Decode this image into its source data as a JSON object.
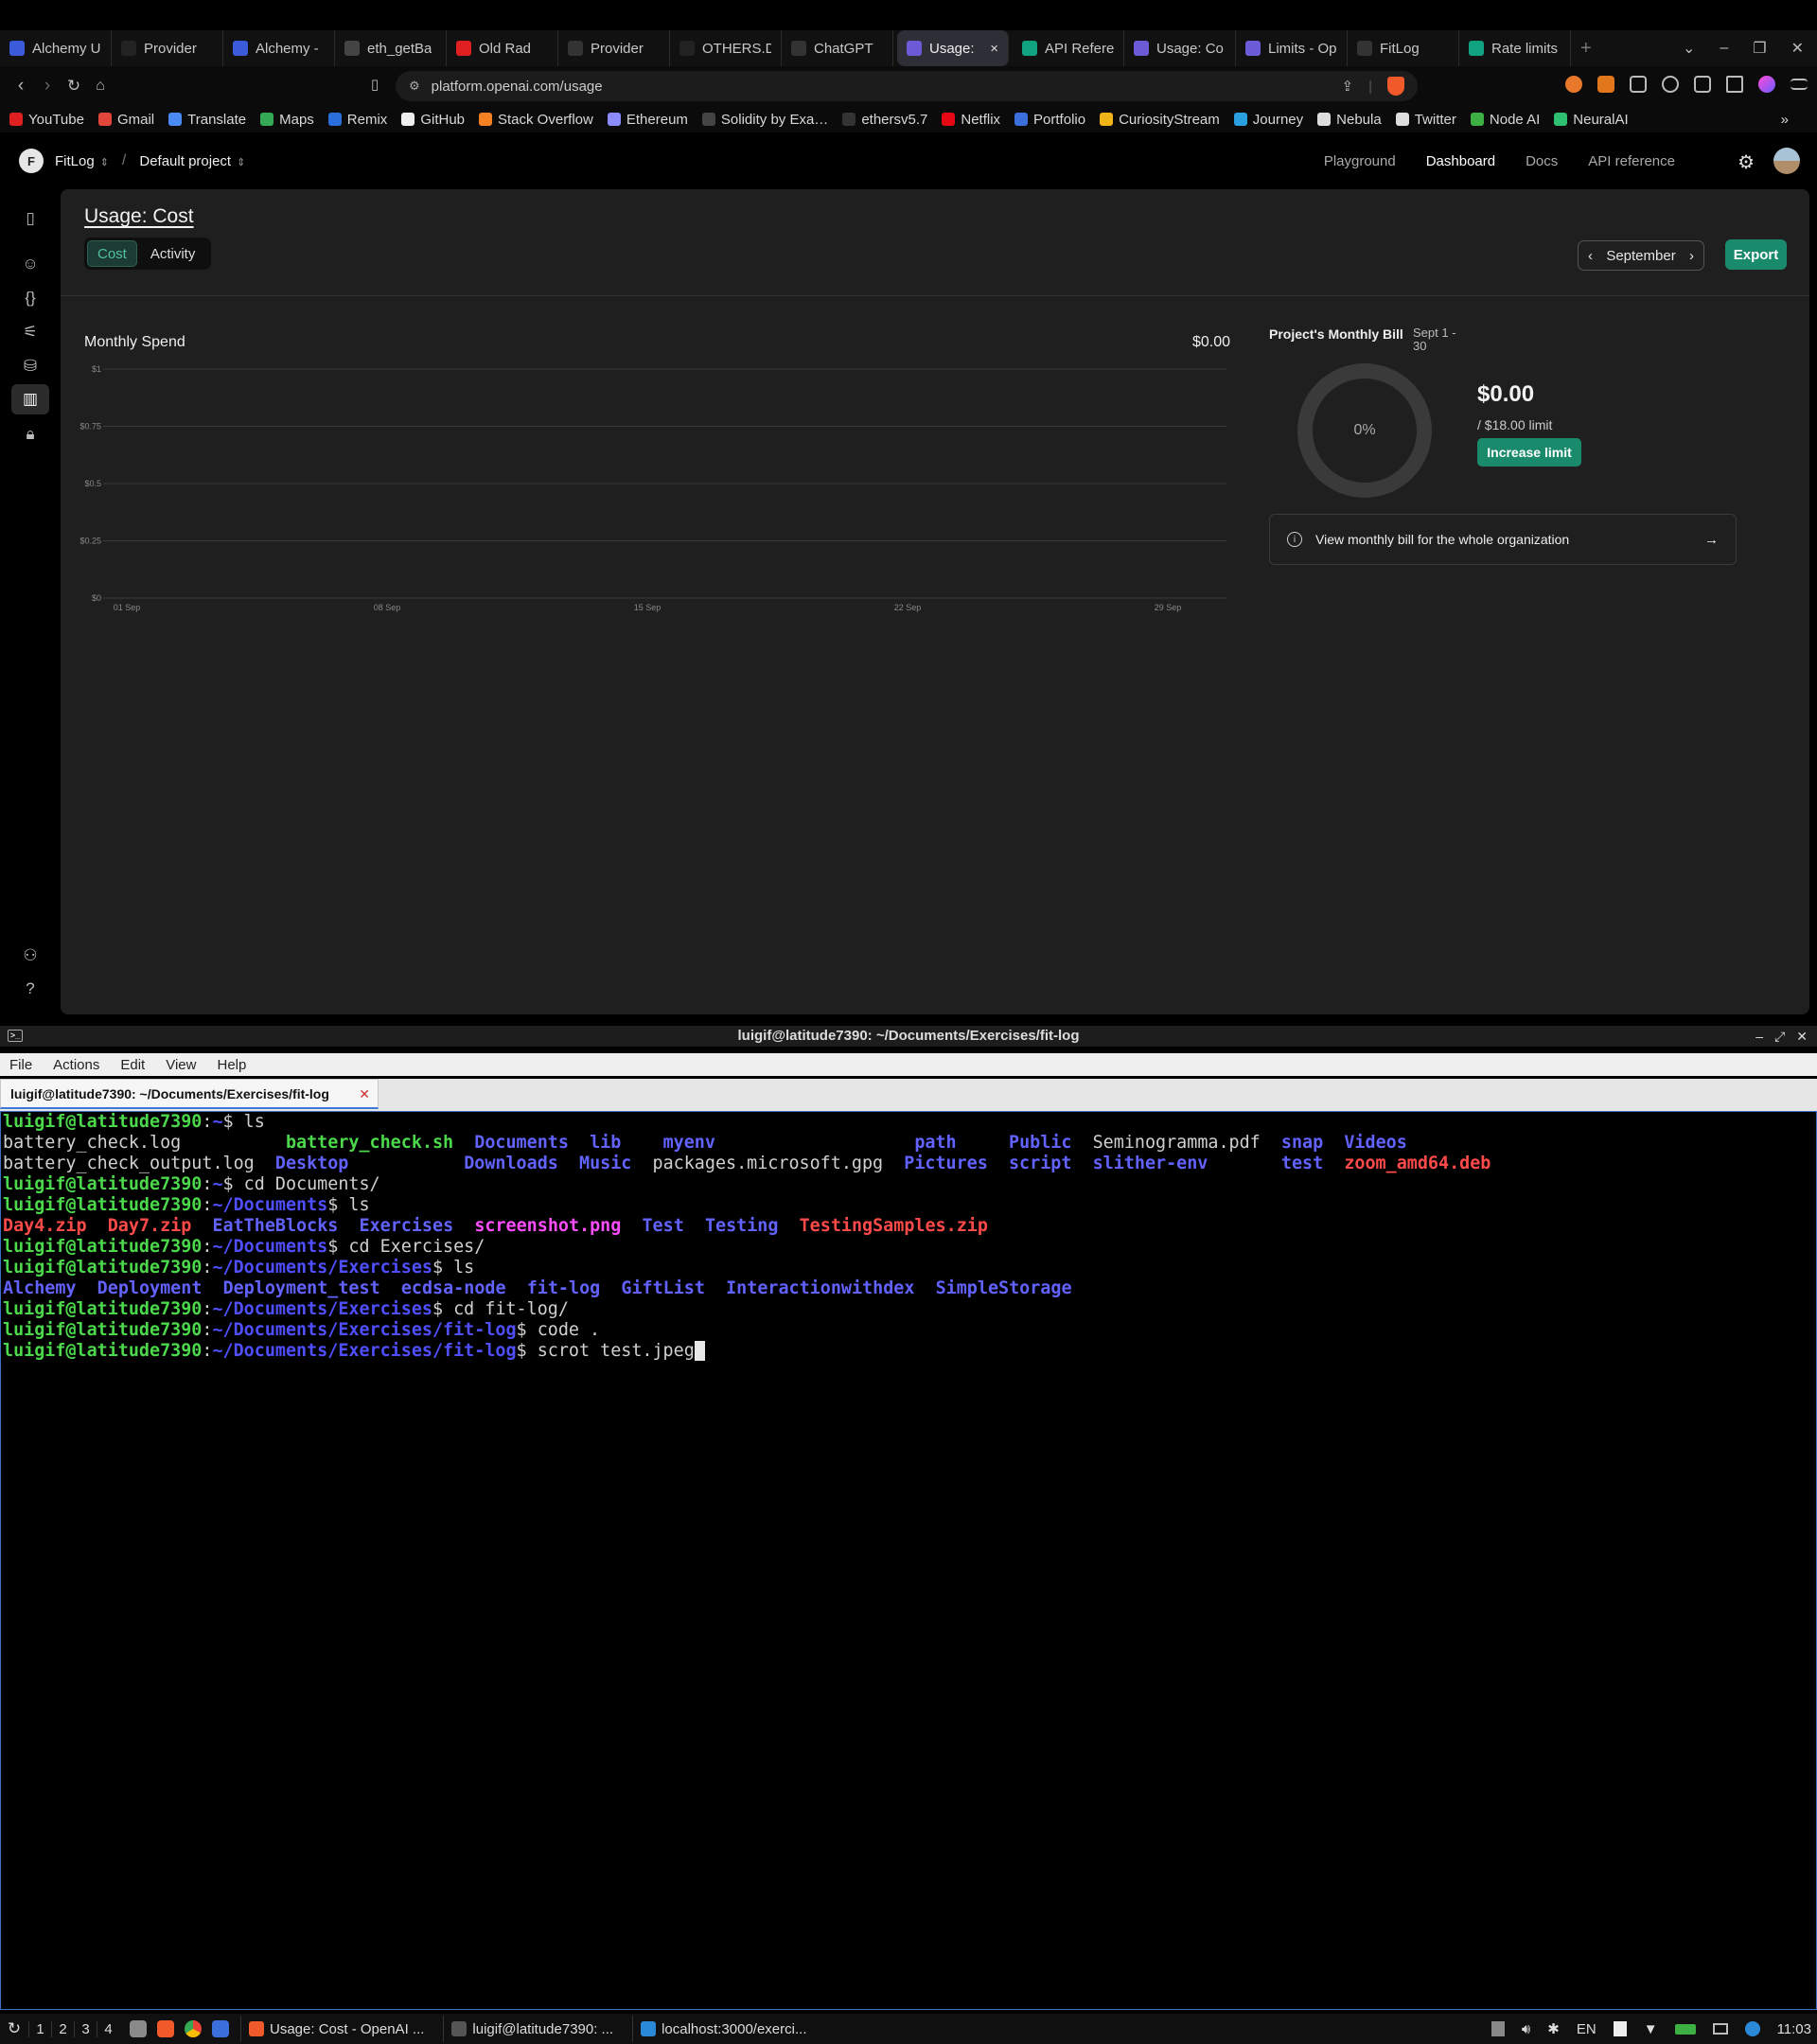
{
  "browser": {
    "tabs": [
      {
        "label": "Alchemy U",
        "color": "#3b5bdb"
      },
      {
        "label": "Provider",
        "color": "#222222"
      },
      {
        "label": "Alchemy - ",
        "color": "#3b5bdb"
      },
      {
        "label": "eth_getBa",
        "color": "#444444"
      },
      {
        "label": "Old Rad",
        "color": "#e02020"
      },
      {
        "label": "Provider",
        "color": "#333333"
      },
      {
        "label": "OTHERS.D",
        "color": "#222222"
      },
      {
        "label": "ChatGPT",
        "color": "#333333"
      },
      {
        "label": "Usage:",
        "color": "#6b5bd6"
      },
      {
        "label": "API Refere",
        "color": "#10a37f"
      },
      {
        "label": "Usage: Co",
        "color": "#6b5bd6"
      },
      {
        "label": "Limits - Op",
        "color": "#6b5bd6"
      },
      {
        "label": "FitLog",
        "color": "#333333"
      },
      {
        "label": "Rate limits",
        "color": "#10a37f"
      }
    ],
    "active_tab_close": "×",
    "new_tab": "+",
    "url": "platform.openai.com/usage",
    "bookmarks": [
      {
        "label": "YouTube",
        "color": "#e02020"
      },
      {
        "label": "Gmail",
        "color": "#e0463a"
      },
      {
        "label": "Translate",
        "color": "#4a8af4"
      },
      {
        "label": "Maps",
        "color": "#34a853"
      },
      {
        "label": "Remix",
        "color": "#2a6fdb"
      },
      {
        "label": "GitHub",
        "color": "#eeeeee"
      },
      {
        "label": "Stack Overflow",
        "color": "#f48024"
      },
      {
        "label": "Ethereum",
        "color": "#8c8cff"
      },
      {
        "label": "Solidity by Exa…",
        "color": "#444444"
      },
      {
        "label": "ethersv5.7",
        "color": "#333333"
      },
      {
        "label": "Netflix",
        "color": "#e50914"
      },
      {
        "label": "Portfolio",
        "color": "#3a6fdc"
      },
      {
        "label": "CuriosityStream",
        "color": "#f1b418"
      },
      {
        "label": "Journey",
        "color": "#2aa0e0"
      },
      {
        "label": "Nebula",
        "color": "#dddddd"
      },
      {
        "label": "Twitter",
        "color": "#dddddd"
      },
      {
        "label": "Node AI",
        "color": "#3cb043"
      },
      {
        "label": "NeuralAI",
        "color": "#2fbf71"
      }
    ]
  },
  "header": {
    "org_initial": "F",
    "org_name": "FitLog",
    "separator": "/",
    "project": "Default project",
    "nav": [
      "Playground",
      "Dashboard",
      "Docs",
      "API reference"
    ]
  },
  "page": {
    "title": "Usage: Cost",
    "tabs": [
      "Cost",
      "Activity"
    ],
    "month": "September",
    "export": "Export"
  },
  "spend": {
    "title": "Monthly Spend",
    "total": "$0.00"
  },
  "chart_data": {
    "type": "bar",
    "title": "Monthly Spend",
    "y_ticks": [
      "$0",
      "$0.25",
      "$0.5",
      "$0.75",
      "$1"
    ],
    "x_ticks": [
      "01 Sep",
      "08 Sep",
      "15 Sep",
      "22 Sep",
      "29 Sep"
    ],
    "ylim": [
      0,
      1
    ],
    "values": [],
    "grid": true
  },
  "bill": {
    "title": "Project's Monthly Bill",
    "range": "Sept 1 - 30",
    "percent": "0%",
    "percent_value": 0,
    "amount": "$0.00",
    "limit": "/ $18.00 limit",
    "increase": "Increase limit",
    "org_link": "View monthly bill for the whole organization"
  },
  "terminal": {
    "title": "luigif@latitude7390: ~/Documents/Exercises/fit-log",
    "menu": [
      "File",
      "Actions",
      "Edit",
      "View",
      "Help"
    ],
    "tab_label": "luigif@latitude7390: ~/Documents/Exercises/fit-log",
    "lines": [
      [
        {
          "t": "luigif@latitude7390",
          "c": "pu"
        },
        {
          "t": ":",
          "c": "plain"
        },
        {
          "t": "~",
          "c": "pp"
        },
        {
          "t": "$ ls",
          "c": "plain"
        }
      ],
      [
        {
          "t": "battery_check.log          ",
          "c": "plain"
        },
        {
          "t": "battery_check.sh",
          "c": "exe"
        },
        {
          "t": "  ",
          "c": "plain"
        },
        {
          "t": "Documents",
          "c": "dir"
        },
        {
          "t": "  ",
          "c": "plain"
        },
        {
          "t": "lib",
          "c": "dir"
        },
        {
          "t": "    ",
          "c": "plain"
        },
        {
          "t": "myenv",
          "c": "dir"
        },
        {
          "t": "                   ",
          "c": "plain"
        },
        {
          "t": "path",
          "c": "dir"
        },
        {
          "t": "     ",
          "c": "plain"
        },
        {
          "t": "Public",
          "c": "dir"
        },
        {
          "t": "  Seminogramma.pdf  ",
          "c": "plain"
        },
        {
          "t": "snap",
          "c": "dir"
        },
        {
          "t": "  ",
          "c": "plain"
        },
        {
          "t": "Videos",
          "c": "dir"
        }
      ],
      [
        {
          "t": "battery_check_output.log  ",
          "c": "plain"
        },
        {
          "t": "Desktop",
          "c": "dir"
        },
        {
          "t": "           ",
          "c": "plain"
        },
        {
          "t": "Downloads",
          "c": "dir"
        },
        {
          "t": "  ",
          "c": "plain"
        },
        {
          "t": "Music",
          "c": "dir"
        },
        {
          "t": "  packages.microsoft.gpg  ",
          "c": "plain"
        },
        {
          "t": "Pictures",
          "c": "dir"
        },
        {
          "t": "  ",
          "c": "plain"
        },
        {
          "t": "script",
          "c": "dir"
        },
        {
          "t": "  ",
          "c": "plain"
        },
        {
          "t": "slither-env",
          "c": "dir"
        },
        {
          "t": "       ",
          "c": "plain"
        },
        {
          "t": "test",
          "c": "dir"
        },
        {
          "t": "  ",
          "c": "plain"
        },
        {
          "t": "zoom_amd64.deb",
          "c": "zip"
        }
      ],
      [
        {
          "t": "luigif@latitude7390",
          "c": "pu"
        },
        {
          "t": ":",
          "c": "plain"
        },
        {
          "t": "~",
          "c": "pp"
        },
        {
          "t": "$ cd Documents/",
          "c": "plain"
        }
      ],
      [
        {
          "t": "luigif@latitude7390",
          "c": "pu"
        },
        {
          "t": ":",
          "c": "plain"
        },
        {
          "t": "~/Documents",
          "c": "pp"
        },
        {
          "t": "$ ls",
          "c": "plain"
        }
      ],
      [
        {
          "t": "Day4.zip",
          "c": "zip"
        },
        {
          "t": "  ",
          "c": "plain"
        },
        {
          "t": "Day7.zip",
          "c": "zip"
        },
        {
          "t": "  ",
          "c": "plain"
        },
        {
          "t": "EatTheBlocks",
          "c": "dir"
        },
        {
          "t": "  ",
          "c": "plain"
        },
        {
          "t": "Exercises",
          "c": "dir"
        },
        {
          "t": "  ",
          "c": "plain"
        },
        {
          "t": "screenshot.png",
          "c": "img"
        },
        {
          "t": "  ",
          "c": "plain"
        },
        {
          "t": "Test",
          "c": "dir"
        },
        {
          "t": "  ",
          "c": "plain"
        },
        {
          "t": "Testing",
          "c": "dir"
        },
        {
          "t": "  ",
          "c": "plain"
        },
        {
          "t": "TestingSamples.zip",
          "c": "zip"
        }
      ],
      [
        {
          "t": "luigif@latitude7390",
          "c": "pu"
        },
        {
          "t": ":",
          "c": "plain"
        },
        {
          "t": "~/Documents",
          "c": "pp"
        },
        {
          "t": "$ cd Exercises/",
          "c": "plain"
        }
      ],
      [
        {
          "t": "luigif@latitude7390",
          "c": "pu"
        },
        {
          "t": ":",
          "c": "plain"
        },
        {
          "t": "~/Documents/Exercises",
          "c": "pp"
        },
        {
          "t": "$ ls",
          "c": "plain"
        }
      ],
      [
        {
          "t": "Alchemy",
          "c": "dir"
        },
        {
          "t": "  ",
          "c": "plain"
        },
        {
          "t": "Deployment",
          "c": "dir"
        },
        {
          "t": "  ",
          "c": "plain"
        },
        {
          "t": "Deployment_test",
          "c": "dir"
        },
        {
          "t": "  ",
          "c": "plain"
        },
        {
          "t": "ecdsa-node",
          "c": "dir"
        },
        {
          "t": "  ",
          "c": "plain"
        },
        {
          "t": "fit-log",
          "c": "dir"
        },
        {
          "t": "  ",
          "c": "plain"
        },
        {
          "t": "GiftList",
          "c": "dir"
        },
        {
          "t": "  ",
          "c": "plain"
        },
        {
          "t": "Interactionwithdex",
          "c": "dir"
        },
        {
          "t": "  ",
          "c": "plain"
        },
        {
          "t": "SimpleStorage",
          "c": "dir"
        }
      ],
      [
        {
          "t": "luigif@latitude7390",
          "c": "pu"
        },
        {
          "t": ":",
          "c": "plain"
        },
        {
          "t": "~/Documents/Exercises",
          "c": "pp"
        },
        {
          "t": "$ cd fit-log/",
          "c": "plain"
        }
      ],
      [
        {
          "t": "luigif@latitude7390",
          "c": "pu"
        },
        {
          "t": ":",
          "c": "plain"
        },
        {
          "t": "~/Documents/Exercises/fit-log",
          "c": "pp"
        },
        {
          "t": "$ code .",
          "c": "plain"
        }
      ],
      [
        {
          "t": "luigif@latitude7390",
          "c": "pu"
        },
        {
          "t": ":",
          "c": "plain"
        },
        {
          "t": "~/Documents/Exercises/fit-log",
          "c": "pp"
        },
        {
          "t": "$ scrot test.jpeg",
          "c": "plain"
        },
        {
          "t": " ",
          "c": "cursor"
        }
      ]
    ]
  },
  "taskbar": {
    "workspaces": [
      "1",
      "2",
      "3",
      "4"
    ],
    "tasks": [
      {
        "label": "Usage: Cost - OpenAI ...",
        "color": "#f0592a"
      },
      {
        "label": "luigif@latitude7390: ...",
        "color": "#555555"
      },
      {
        "label": "localhost:3000/exerci...",
        "color": "#2a8ad8"
      }
    ],
    "lang": "EN",
    "clock": "11:03"
  }
}
